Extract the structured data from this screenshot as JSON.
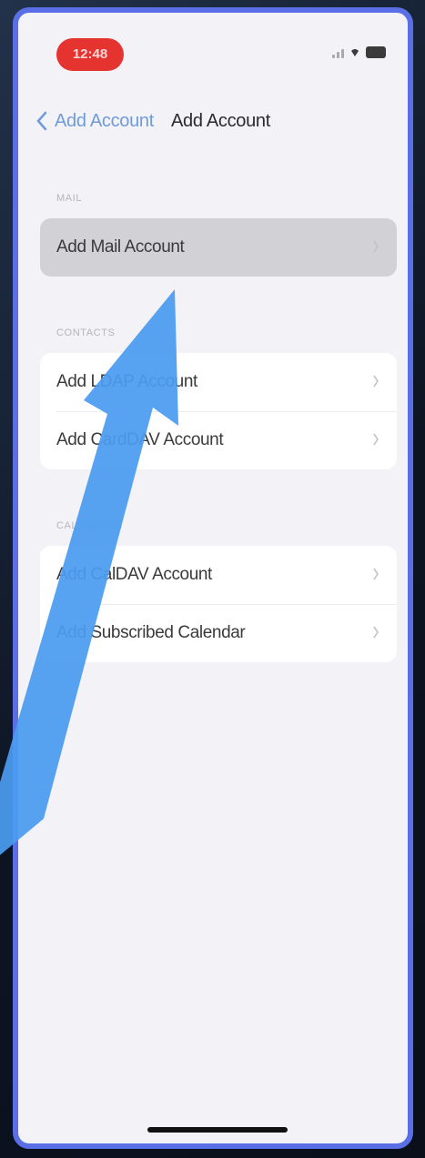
{
  "status_bar": {
    "time": "12:48"
  },
  "nav": {
    "back_label": "Add Account",
    "title": "Add Account"
  },
  "sections": {
    "mail": {
      "header": "MAIL",
      "rows": [
        "Add Mail Account"
      ]
    },
    "contacts": {
      "header": "CONTACTS",
      "rows": [
        "Add LDAP Account",
        "Add CardDAV Account"
      ]
    },
    "calendars": {
      "header": "CALENDARS",
      "rows": [
        "Add CalDAV Account",
        "Add Subscribed Calendar"
      ]
    }
  },
  "annotation": {
    "arrow_color": "#4a9cf0",
    "icon": "pointer-arrow"
  },
  "colors": {
    "frame": "#5a6fe6",
    "time_pill": "#e5332f",
    "link": "#6f9bd8",
    "background": "#f2f2f7",
    "highlight": "#d1d1d6"
  }
}
